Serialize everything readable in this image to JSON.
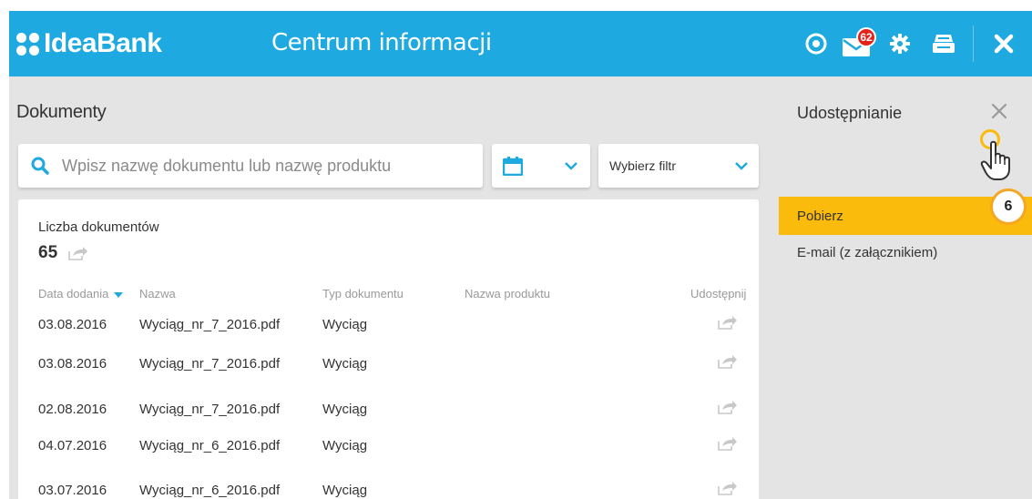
{
  "header": {
    "logo": "IdeaBank",
    "title": "Centrum informacji",
    "mail_badge": "62",
    "icons": [
      "target-icon",
      "mail-icon",
      "gear-icon",
      "printer-icon",
      "close-icon"
    ],
    "accent": "#1ea9e1"
  },
  "main": {
    "title": "Dokumenty",
    "search_placeholder": "Wpisz nazwę dokumentu lub nazwę produktu",
    "filter_label": "Wybierz filtr",
    "count_label": "Liczba dokumentów",
    "count_value": "65",
    "columns": {
      "date": "Data dodania",
      "name": "Nazwa",
      "type": "Typ dokumentu",
      "product": "Nazwa produktu",
      "share": "Udostępnij"
    },
    "rows": [
      {
        "date": "03.08.2016",
        "name": "Wyciąg_nr_7_2016.pdf",
        "type": "Wyciąg",
        "product": ""
      },
      {
        "date": "03.08.2016",
        "name": "Wyciąg_nr_7_2016.pdf",
        "type": "Wyciąg",
        "product": ""
      },
      {
        "date": "02.08.2016",
        "name": "Wyciąg_nr_7_2016.pdf",
        "type": "Wyciąg",
        "product": ""
      },
      {
        "date": "04.07.2016",
        "name": "Wyciąg_nr_6_2016.pdf",
        "type": "Wyciąg",
        "product": ""
      },
      {
        "date": "03.07.2016",
        "name": "Wyciąg_nr_6_2016.pdf",
        "type": "Wyciąg",
        "product": ""
      }
    ]
  },
  "share_panel": {
    "title": "Udostępnianie",
    "options": [
      "Pobierz",
      "E-mail (z załącznikiem)"
    ],
    "highlight_color": "#fbbb0c"
  },
  "step_badge": "6"
}
